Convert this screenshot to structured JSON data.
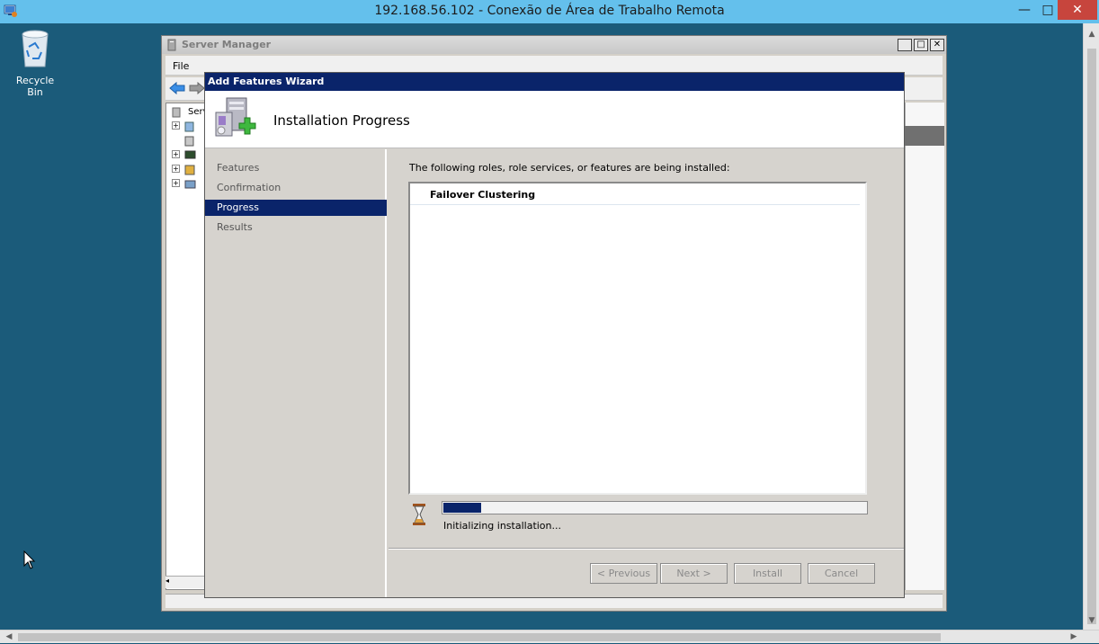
{
  "rdp": {
    "title": "192.168.56.102 - Conexão de Área de Trabalho Remota",
    "min_symbol": "—",
    "max_symbol": "□",
    "close_symbol": "✕",
    "app_icon": "remote-desktop-icon"
  },
  "desktop": {
    "recycle_bin_label": "Recycle Bin"
  },
  "server_manager": {
    "title": "Server Manager",
    "menu_file": "File"
  },
  "wizard": {
    "title": "Add Features Wizard",
    "header_title": "Installation Progress",
    "steps": [
      {
        "label": "Features",
        "active": false
      },
      {
        "label": "Confirmation",
        "active": false
      },
      {
        "label": "Progress",
        "active": true
      },
      {
        "label": "Results",
        "active": false
      }
    ],
    "description": "The following roles, role services, or features are being installed:",
    "install_items": [
      "Failover Clustering"
    ],
    "progress": {
      "percent": 9,
      "status": "Initializing installation..."
    },
    "buttons": {
      "previous": "< Previous",
      "next": "Next >",
      "install": "Install",
      "cancel": "Cancel"
    }
  },
  "colors": {
    "desktop": "#1b5b7a",
    "rdp_titlebar": "#64c0ec",
    "wizard_titlebar": "#0a246a",
    "active_step": "#0a246a",
    "progress": "#0a246a"
  }
}
